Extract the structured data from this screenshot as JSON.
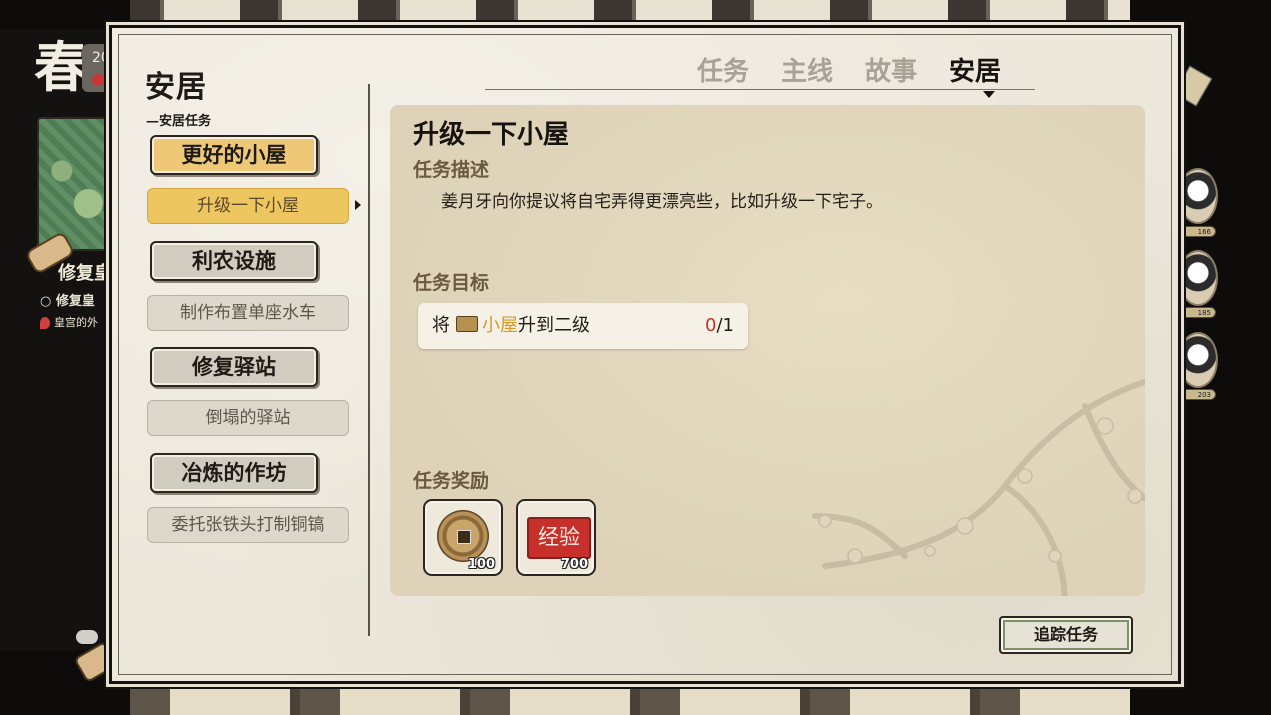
{
  "hud": {
    "season": "春",
    "date_digits": "20",
    "quest_title": "修复皇",
    "quest_sub": "修复皇",
    "quest_location": "皇宫的外",
    "char_levels": [
      "166",
      "185",
      "203"
    ]
  },
  "window": {
    "title": "安居",
    "category_label": "—安居任务"
  },
  "tabs": [
    {
      "label": "任务",
      "active": false
    },
    {
      "label": "主线",
      "active": false
    },
    {
      "label": "故事",
      "active": false
    },
    {
      "label": "安居",
      "active": true
    }
  ],
  "quest_groups": [
    {
      "title": "更好的小屋",
      "active": true,
      "sub": "升级一下小屋",
      "sub_active": true
    },
    {
      "title": "利农设施",
      "active": false,
      "sub": "制作布置单座水车",
      "sub_active": false
    },
    {
      "title": "修复驿站",
      "active": false,
      "sub": "倒塌的驿站",
      "sub_active": false
    },
    {
      "title": "冶炼的作坊",
      "active": false,
      "sub": "委托张铁头打制铜镐",
      "sub_active": false
    }
  ],
  "detail": {
    "title": "升级一下小屋",
    "desc_header": "任务描述",
    "desc": "姜月牙向你提议将自宅弄得更漂亮些，比如升级一下宅子。",
    "objective_header": "任务目标",
    "objective": {
      "prefix": "将",
      "icon": "house-icon",
      "target": "小屋",
      "suffix": "升到二级",
      "current": "0",
      "total": "/1"
    },
    "reward_header": "任务奖励",
    "rewards": [
      {
        "icon": "copper-coin-icon",
        "count": "100"
      },
      {
        "icon": "experience-stamp-icon",
        "label": "经验",
        "count": "700"
      }
    ]
  },
  "track_button": "追踪任务",
  "colors": {
    "active_button": "#eec876",
    "panel_bg": "#ded3b8",
    "window_bg": "#ede8dc",
    "section_header": "#6a5a3e",
    "progress_current": "#c0352a",
    "target_highlight": "#d69a28"
  }
}
